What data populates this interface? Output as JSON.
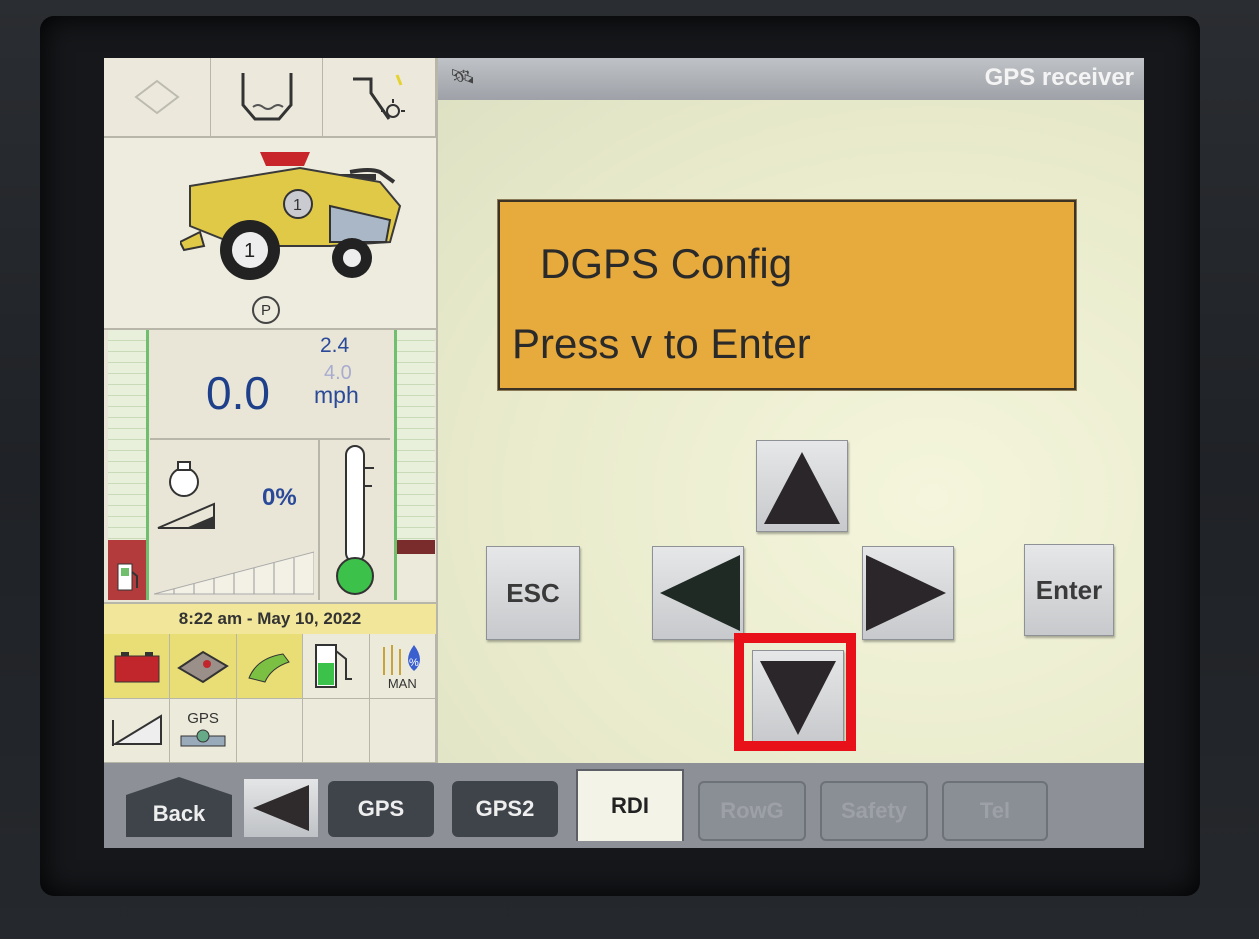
{
  "window": {
    "title": "GPS receiver"
  },
  "status": {
    "speed": "0.0",
    "speed_set1": "2.4",
    "speed_set2": "4.0",
    "speed_unit": "mph",
    "engine_load": "0%",
    "datetime": "8:22 am - May 10, 2022",
    "park_symbol": "P",
    "grid_labels": {
      "man": "MAN",
      "gps": "GPS"
    }
  },
  "dialog": {
    "line1": "DGPS Config",
    "line2": "Press v to Enter"
  },
  "keys": {
    "esc": "ESC",
    "enter": "Enter"
  },
  "tabs": {
    "back": "Back",
    "gps": "GPS",
    "gps2": "GPS2",
    "rdi": "RDI",
    "rowg": "RowG",
    "safety": "Safety",
    "tel": "Tel",
    "active": "RDI"
  },
  "colors": {
    "dialog_bg": "#e6aa3d",
    "highlight": "#e8111a",
    "speed_text": "#1e3f8a",
    "gauge_green": "#6fbf6f"
  },
  "icons": [
    "satellite-icon",
    "grain-tank-icon",
    "unload-auger-icon",
    "combine-icon",
    "engine-icon",
    "thermometer-icon",
    "fuel-icon",
    "battery-icon",
    "service-icon",
    "header-icon",
    "def-icon",
    "moisture-icon",
    "slope-icon"
  ]
}
